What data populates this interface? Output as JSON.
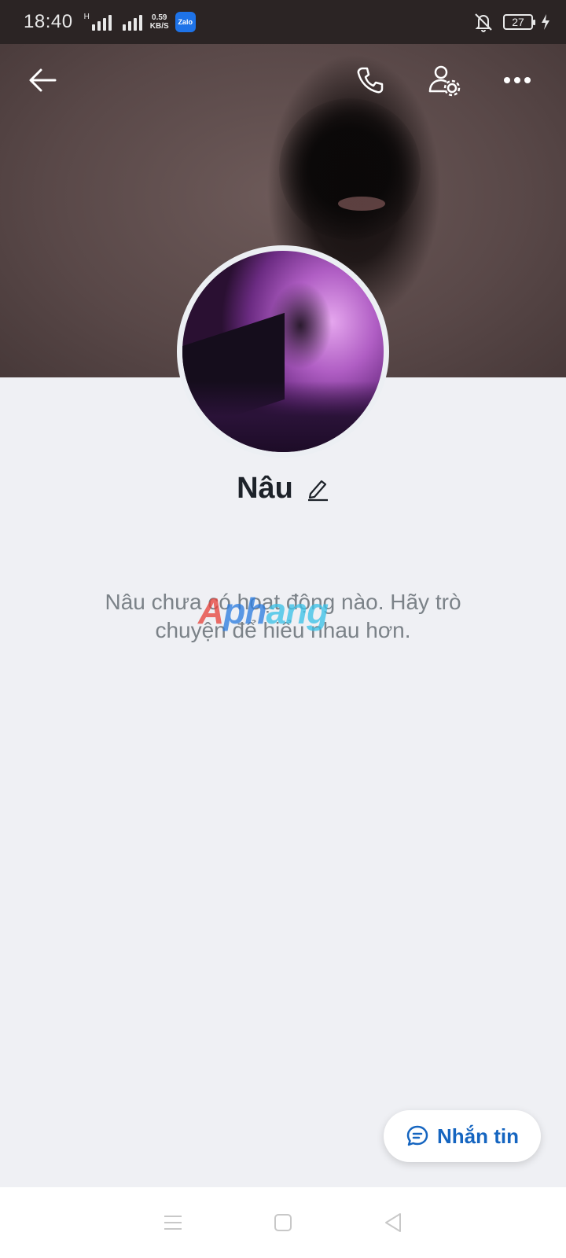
{
  "status_bar": {
    "time": "18:40",
    "network_type": "H",
    "net_speed_value": "0.59",
    "net_speed_unit": "KB/S",
    "app_icon_label": "Zalo",
    "battery_level": "27"
  },
  "header": {
    "back_icon": "arrow-left-icon",
    "call_icon": "phone-icon",
    "settings_icon": "user-settings-icon",
    "more_icon": "more-horizontal-icon"
  },
  "profile": {
    "name": "Nâu",
    "edit_icon": "pencil-icon"
  },
  "empty_state": {
    "message": "Nâu chưa có hoạt động nào. Hãy trò chuyện để hiểu nhau hơn."
  },
  "watermark": {
    "part1": "A",
    "part2": "ph",
    "part3": "ang"
  },
  "message_button": {
    "label": "Nhắn tin",
    "icon": "chat-bubble-icon"
  },
  "nav_bar": {
    "menu_icon": "menu-icon",
    "home_icon": "square-icon",
    "back_icon": "triangle-back-icon"
  },
  "colors": {
    "accent": "#1565c0",
    "background": "#eff0f4"
  }
}
